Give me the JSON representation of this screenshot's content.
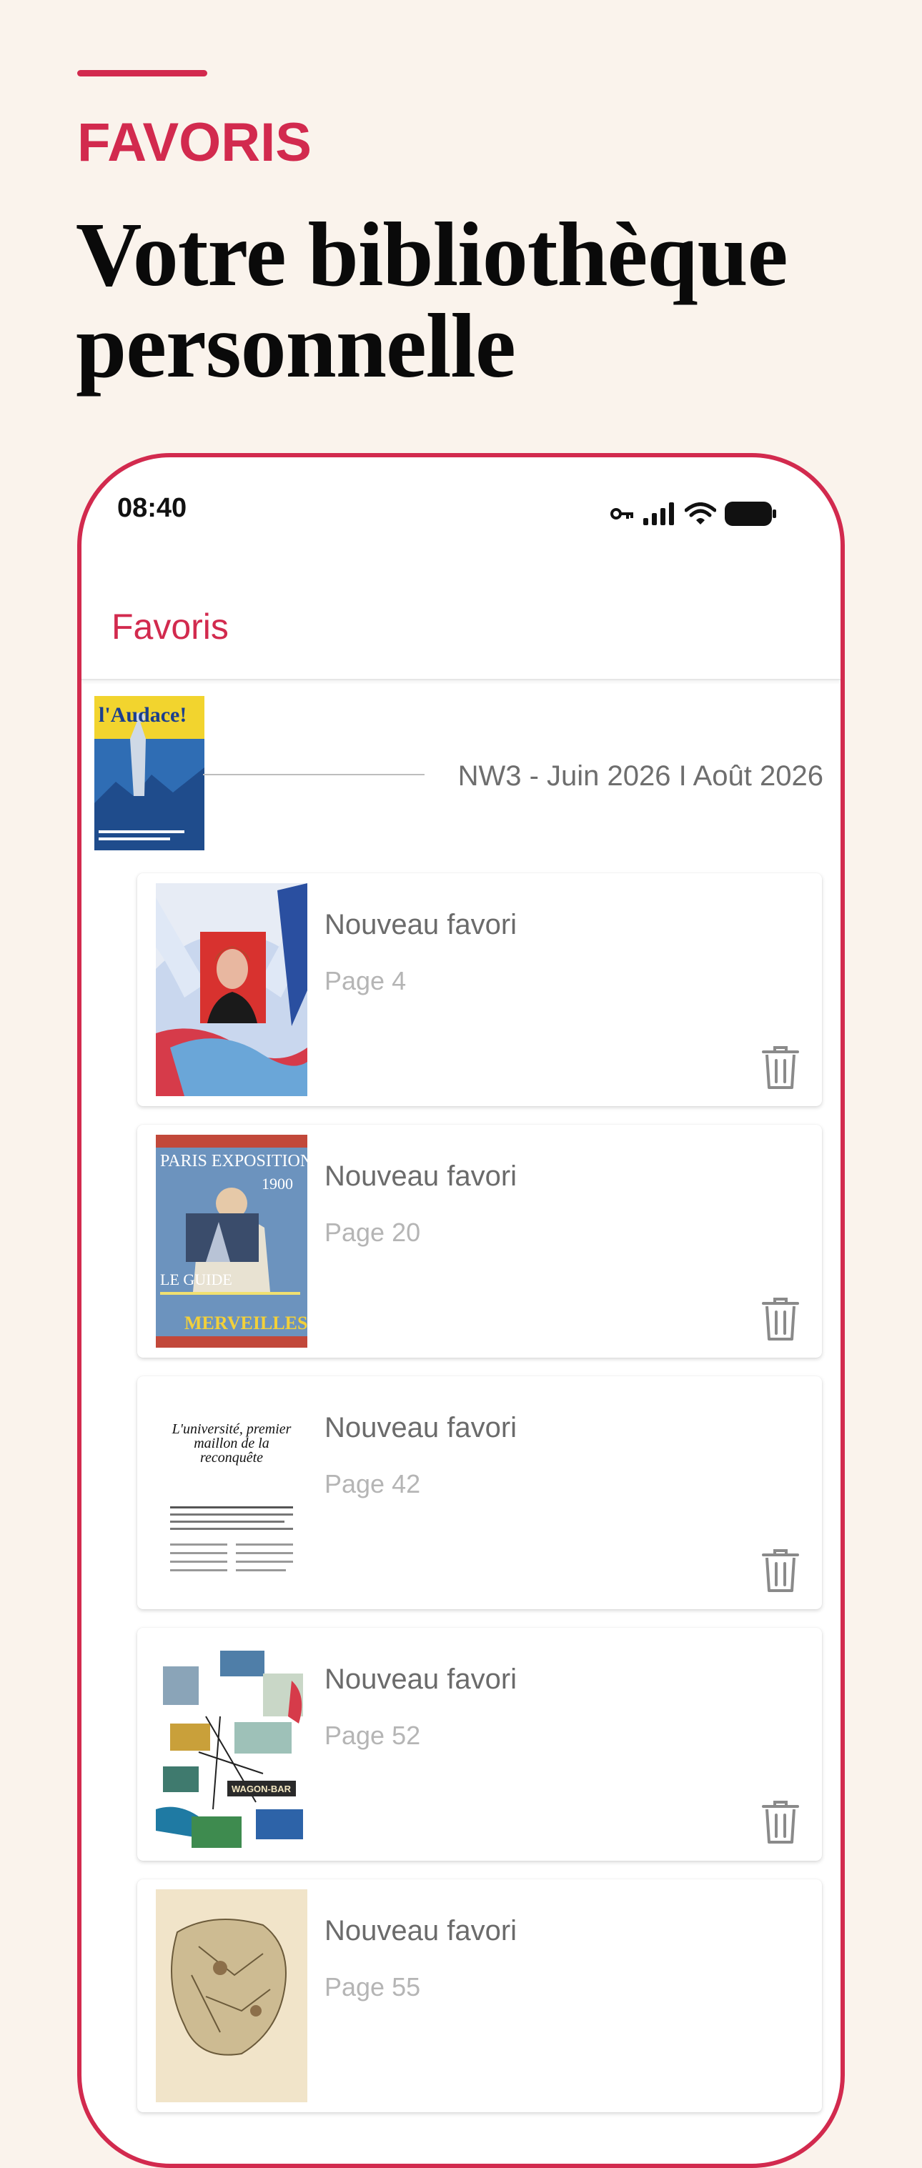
{
  "header": {
    "eyebrow": "FAVORIS",
    "title_line1": "Votre bibliothèque",
    "title_line2": "personnelle",
    "accent_color": "#d22a4e"
  },
  "phone": {
    "status_time": "08:40",
    "appbar_title": "Favoris",
    "issue": {
      "title": "NW3 - Juin 2026 I Août 2026",
      "cover_masthead": "l'Audace!"
    },
    "favorites": [
      {
        "title": "Nouveau favori",
        "page": "Page 4",
        "thumb": "angel-portrait"
      },
      {
        "title": "Nouveau favori",
        "page": "Page 20",
        "thumb": "paris-exposition-poster"
      },
      {
        "title": "Nouveau favori",
        "page": "Page 42",
        "thumb": "article-page"
      },
      {
        "title": "Nouveau favori",
        "page": "Page 52",
        "thumb": "collage-page"
      },
      {
        "title": "Nouveau favori",
        "page": "Page 55",
        "thumb": "map-page"
      }
    ],
    "thumb_text": {
      "poster_title": "PARIS EXPOSITION",
      "poster_year": "1900",
      "poster_guide": "LE GUIDE",
      "poster_merveilles": "MERVEILLES",
      "article_headline": "L'université, premier maillon de la reconquête",
      "collage_label": "WAGON-BAR"
    }
  }
}
